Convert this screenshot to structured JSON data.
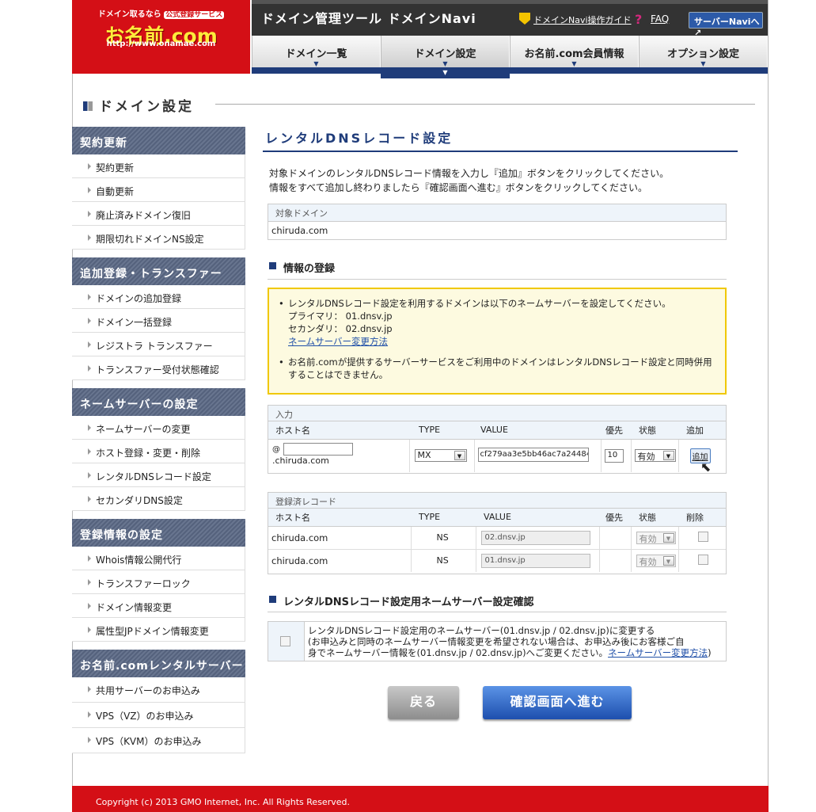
{
  "logo": {
    "line1": "ドメイン取るなら",
    "tag": "公式登録サービス",
    "tag2": ".com .jp .co.jp",
    "brand": "お名前.com",
    "url": "http://www.onamae.com"
  },
  "header": {
    "title": "ドメイン管理ツール ドメインNavi",
    "guide": "ドメインNavi操作ガイド",
    "faq": "FAQ",
    "server_navi": "サーバーNaviへ ↗"
  },
  "nav": {
    "tabs": [
      "ドメイン一覧",
      "ドメイン設定",
      "お名前.com会員情報",
      "オプション設定"
    ],
    "active": 1
  },
  "section_title": "ドメイン設定",
  "sidebar": {
    "groups": [
      {
        "title": "契約更新",
        "items": [
          "契約更新",
          "自動更新",
          "廃止済みドメイン復旧",
          "期限切れドメインNS設定"
        ]
      },
      {
        "title": "追加登録・トランスファー",
        "items": [
          "ドメインの追加登録",
          "ドメイン一括登録",
          "レジストラ トランスファー",
          "トランスファー受付状態確認"
        ]
      },
      {
        "title": "ネームサーバーの設定",
        "items": [
          "ネームサーバーの変更",
          "ホスト登録・変更・削除",
          "レンタルDNSレコード設定",
          "セカンダリDNS設定"
        ]
      },
      {
        "title": "登録情報の設定",
        "items": [
          "Whois情報公開代行",
          "トランスファーロック",
          "ドメイン情報変更",
          "属性型JPドメイン情報変更"
        ]
      },
      {
        "title": "お名前.comレンタルサーバー",
        "items": [
          "共用サーバーのお申込み",
          "VPS（VZ）のお申込み",
          "VPS（KVM）のお申込み"
        ]
      }
    ]
  },
  "main": {
    "heading": "レンタルDNSレコード設定",
    "desc1": "対象ドメインのレンタルDNSレコード情報を入力し『追加』ボタンをクリックしてください。",
    "desc2": "情報をすべて追加し終わりましたら『確認画面へ進む』ボタンをクリックしてください。",
    "target_label": "対象ドメイン",
    "target_value": "chiruda.com",
    "reg_heading": "情報の登録",
    "notice": {
      "line1": "レンタルDNSレコード設定を利用するドメインは以下のネームサーバーを設定してください。",
      "primary": "プライマリ： 01.dnsv.jp",
      "secondary": "セカンダリ： 02.dnsv.jp",
      "link": "ネームサーバー変更方法",
      "line2": "お名前.comが提供するサーバーサービスをご利用中のドメインはレンタルDNSレコード設定と同時併用することはできません。"
    },
    "input": {
      "caption": "入力",
      "headers": [
        "ホスト名",
        "TYPE",
        "VALUE",
        "優先",
        "状態",
        "追加"
      ],
      "at": "@",
      "host_value": "",
      "host_suffix": ".chiruda.com",
      "type": "MX",
      "value": "cf279aa3e5bb46ac7a24484",
      "priority": "10",
      "status": "有効",
      "add_button": "追加"
    },
    "records": {
      "caption": "登録済レコード",
      "headers": [
        "ホスト名",
        "TYPE",
        "VALUE",
        "優先",
        "状態",
        "削除"
      ],
      "rows": [
        {
          "host": "chiruda.com",
          "type": "NS",
          "value": "02.dnsv.jp",
          "priority": "",
          "status": "有効"
        },
        {
          "host": "chiruda.com",
          "type": "NS",
          "value": "01.dnsv.jp",
          "priority": "",
          "status": "有効"
        }
      ]
    },
    "ns_heading": "レンタルDNSレコード設定用ネームサーバー設定確認",
    "ns_confirm": {
      "line1": "レンタルDNSレコード設定用のネームサーバー(01.dnsv.jp / 02.dnsv.jp)に変更する",
      "line2": "(お申込みと同時のネームサーバー情報変更を希望されない場合は、お申込み後にお客様ご自",
      "line3": "身でネームサーバー情報を(01.dnsv.jp / 02.dnsv.jp)へご変更ください。",
      "link": "ネームサーバー変更方法",
      "close": ")"
    },
    "back_button": "戻る",
    "confirm_button": "確認画面へ進む"
  },
  "footer": "Copyright (c) 2013 GMO Internet, Inc. All Rights Reserved.",
  "colors": {
    "brand_red": "#d40f16",
    "navy": "#1f3c7a",
    "notice_border": "#f0c800"
  }
}
